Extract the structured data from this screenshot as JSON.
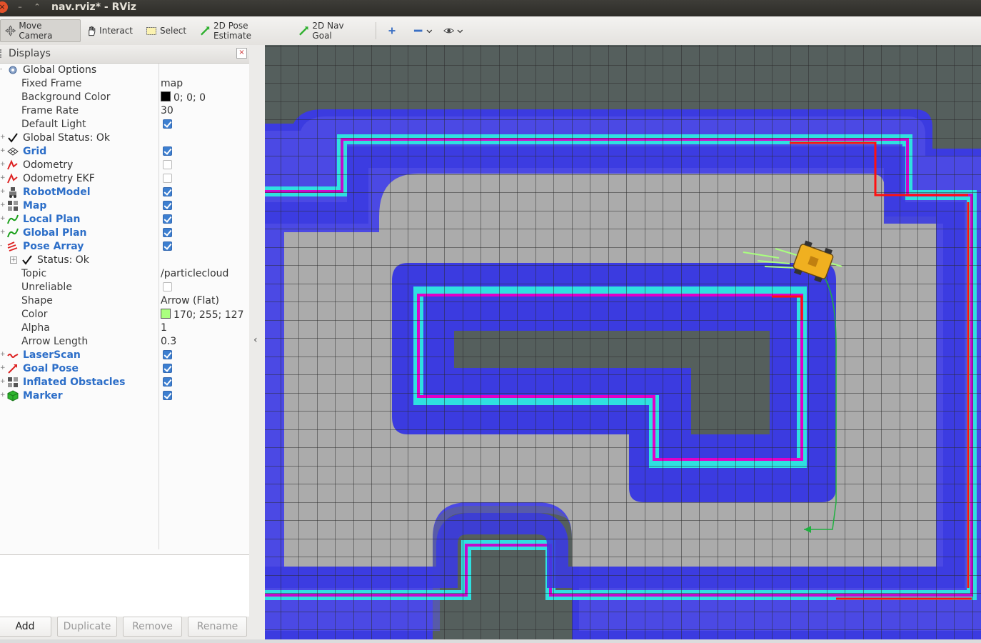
{
  "window": {
    "title": "nav.rviz* - RViz"
  },
  "toolbar": {
    "move_camera": "Move Camera",
    "interact": "Interact",
    "select": "Select",
    "pose_estimate": "2D Pose Estimate",
    "nav_goal": "2D Nav Goal"
  },
  "displays": {
    "title": "Displays",
    "rows": [
      {
        "label": "Global Options",
        "value": ""
      },
      {
        "label": "Fixed Frame",
        "value": "map"
      },
      {
        "label": "Background Color",
        "value": "0; 0; 0"
      },
      {
        "label": "Frame Rate",
        "value": "30"
      },
      {
        "label": "Default Light",
        "value": ""
      },
      {
        "label": "Global Status: Ok",
        "value": ""
      },
      {
        "label": "Grid",
        "value": ""
      },
      {
        "label": "Odometry",
        "value": ""
      },
      {
        "label": "Odometry EKF",
        "value": ""
      },
      {
        "label": "RobotModel",
        "value": ""
      },
      {
        "label": "Map",
        "value": ""
      },
      {
        "label": "Local Plan",
        "value": ""
      },
      {
        "label": "Global Plan",
        "value": ""
      },
      {
        "label": "Pose Array",
        "value": ""
      },
      {
        "label": "Status: Ok",
        "value": ""
      },
      {
        "label": "Topic",
        "value": "/particlecloud"
      },
      {
        "label": "Unreliable",
        "value": ""
      },
      {
        "label": "Shape",
        "value": "Arrow (Flat)"
      },
      {
        "label": "Color",
        "value": "170; 255; 127"
      },
      {
        "label": "Alpha",
        "value": "1"
      },
      {
        "label": "Arrow Length",
        "value": "0.3"
      },
      {
        "label": "LaserScan",
        "value": ""
      },
      {
        "label": "Goal Pose",
        "value": ""
      },
      {
        "label": "Inflated Obstacles",
        "value": ""
      },
      {
        "label": "Marker",
        "value": ""
      }
    ]
  },
  "buttons": {
    "add": "Add",
    "duplicate": "Duplicate",
    "remove": "Remove",
    "rename": "Rename"
  },
  "colors": {
    "background_swatch": "#000000",
    "particle_swatch": "#aaff7f",
    "map_free": "#ababab",
    "map_unknown": "#555f5d",
    "inflation": "#3d3de0",
    "inflation_core": "#2fe0e0",
    "obstacle": "#e000c8",
    "laser": "#ff1010",
    "robot": "#f0b020"
  }
}
